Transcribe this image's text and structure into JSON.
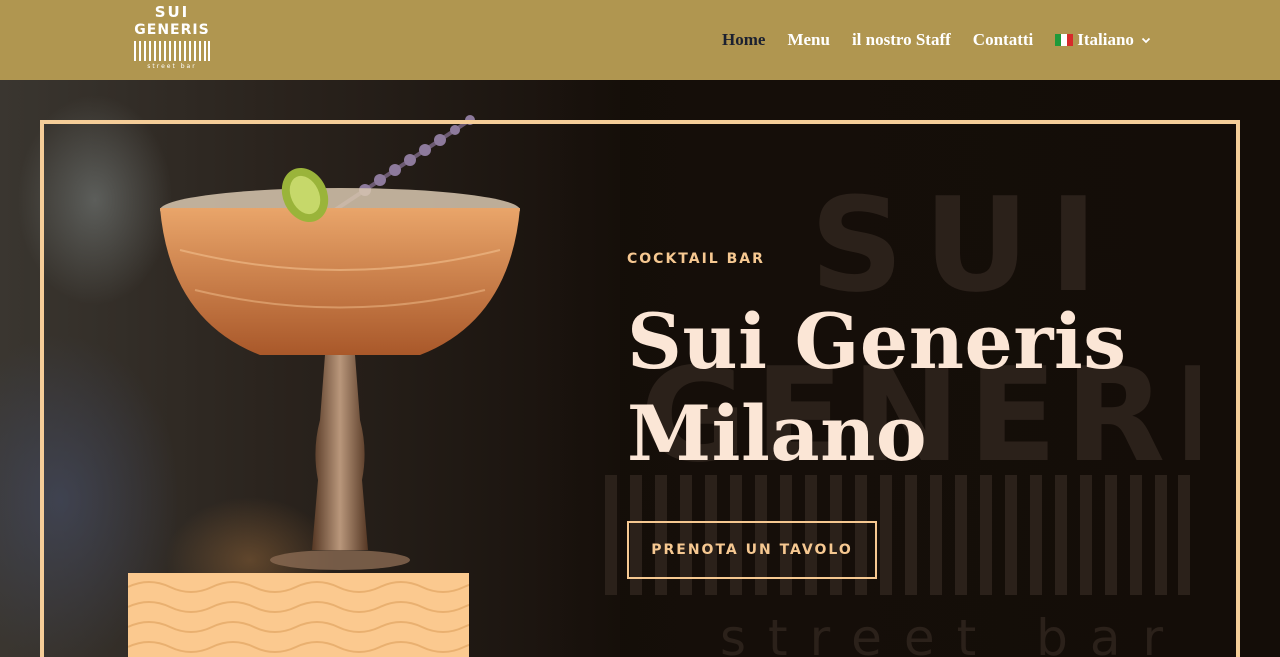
{
  "header": {
    "logo": {
      "line1": "SUI",
      "line2": "GENERIS",
      "line3": "street bar"
    },
    "nav": [
      {
        "label": "Home",
        "active": true
      },
      {
        "label": "Menu",
        "active": false
      },
      {
        "label": "il nostro Staff",
        "active": false
      },
      {
        "label": "Contatti",
        "active": false
      }
    ],
    "language": {
      "label": "Italiano",
      "icon": "italy-flag-icon"
    }
  },
  "hero": {
    "eyebrow": "COCKTAIL BAR",
    "title_line1": "Sui Generis",
    "title_line2": "Milano",
    "cta_label": "PRENOTA UN TAVOLO",
    "watermark": {
      "line1": "SUI",
      "line2": "GENERIS",
      "line3": "street bar"
    }
  },
  "colors": {
    "header_bg": "#b09650",
    "accent": "#f6c891",
    "frame": "#f5cd98",
    "title": "#fbe6d6",
    "nav_active": "#1b2030",
    "pattern_bg": "#fbc98f"
  }
}
